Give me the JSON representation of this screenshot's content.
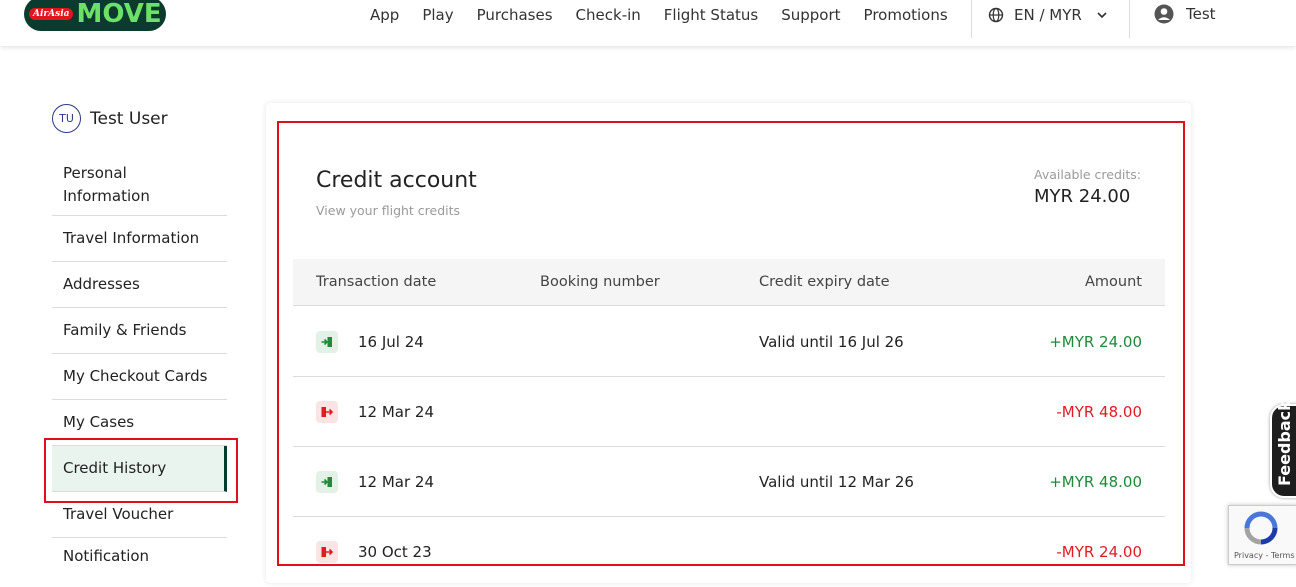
{
  "header": {
    "logo_brand": "AirAsia",
    "logo_word": "MOVE",
    "nav": [
      "App",
      "Play",
      "Purchases",
      "Check-in",
      "Flight Status",
      "Support",
      "Promotions"
    ],
    "language": "EN / MYR",
    "user": "Test"
  },
  "sidebar": {
    "avatar_initials": "TU",
    "user_name": "Test User",
    "items": [
      {
        "label": "Personal Information",
        "active": false
      },
      {
        "label": "Travel Information",
        "active": false
      },
      {
        "label": "Addresses",
        "active": false
      },
      {
        "label": "Family & Friends",
        "active": false
      },
      {
        "label": "My Checkout Cards",
        "active": false
      },
      {
        "label": "My Cases",
        "active": false
      },
      {
        "label": "Credit History",
        "active": true
      },
      {
        "label": "Travel Voucher",
        "active": false
      },
      {
        "label": "Notification",
        "active": false
      }
    ]
  },
  "credit": {
    "title": "Credit account",
    "subtitle": "View your flight credits",
    "available_label": "Available credits:",
    "available_value": "MYR 24.00",
    "columns": [
      "Transaction date",
      "Booking number",
      "Credit expiry date",
      "Amount"
    ],
    "rows": [
      {
        "type": "in",
        "date": "16 Jul 24",
        "booking": "",
        "expiry": "Valid until 16 Jul 26",
        "amount": "+MYR 24.00"
      },
      {
        "type": "out",
        "date": "12 Mar 24",
        "booking": "",
        "expiry": "",
        "amount": "-MYR 48.00"
      },
      {
        "type": "in",
        "date": "12 Mar 24",
        "booking": "",
        "expiry": "Valid until 12 Mar 26",
        "amount": "+MYR 48.00"
      },
      {
        "type": "out",
        "date": "30 Oct 23",
        "booking": "",
        "expiry": "",
        "amount": "-MYR 24.00"
      }
    ]
  },
  "widgets": {
    "feedback": "Feedback",
    "recaptcha_text": "Privacy - Terms"
  },
  "colors": {
    "brand_dark": "#0b3b2e",
    "positive": "#1e8a3a",
    "negative": "#e21b22",
    "highlight": "#e0101a"
  }
}
